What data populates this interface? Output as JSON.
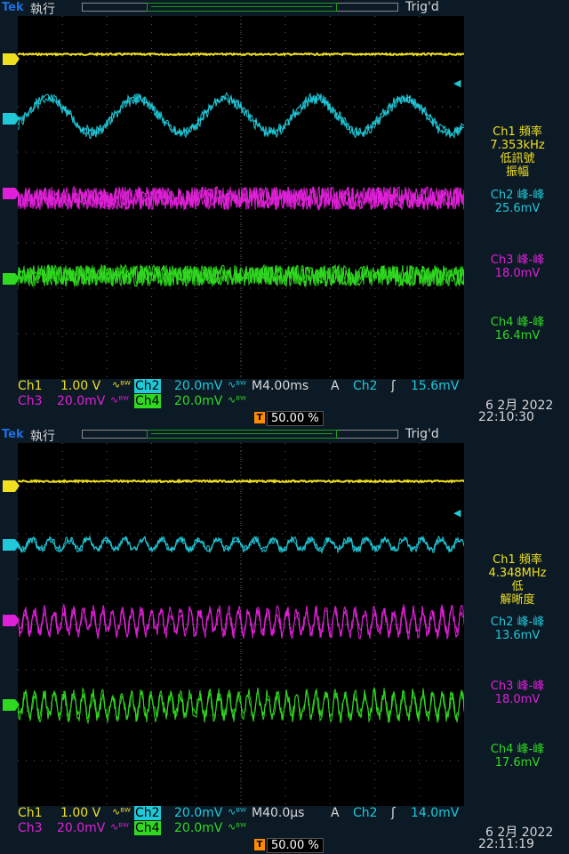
{
  "panels": [
    {
      "brand": "Tek",
      "run_state": "執行",
      "trig_status": "Trig'd",
      "trig_marker": "T",
      "channel_markers": [
        "1",
        "2",
        "3",
        "4"
      ],
      "measurements": {
        "ch1": [
          "Ch1 頻率",
          "7.353kHz",
          "低訊號",
          "振幅"
        ],
        "ch2": [
          "Ch2 峰-峰",
          "25.6mV"
        ],
        "ch3": [
          "Ch3 峰-峰",
          "18.0mV"
        ],
        "ch4": [
          "Ch4 峰-峰",
          "16.4mV"
        ]
      },
      "readout": {
        "ch1_label": "Ch1",
        "ch1_scale": "1.00 V",
        "ch2_label": "Ch2",
        "ch2_scale": "20.0mV",
        "ch3_label": "Ch3",
        "ch3_scale": "20.0mV",
        "ch4_label": "Ch4",
        "ch4_scale": "20.0mV",
        "coupling": "∿ᴮᵂ",
        "timebase": "M4.00ms",
        "trig_mode": "A",
        "trig_source": "Ch2",
        "trig_slope": "ʃ",
        "trig_level": "15.6mV",
        "trig_position": "50.00 %",
        "date": "6 2月  2022",
        "time": "22:10:30"
      },
      "waveforms": {
        "ch2_shape": "slow-sine",
        "ch2_cycles": 5
      }
    },
    {
      "brand": "Tek",
      "run_state": "執行",
      "trig_status": "Trig'd",
      "trig_marker": "T",
      "channel_markers": [
        "1",
        "2",
        "3",
        "4"
      ],
      "measurements": {
        "ch1": [
          "Ch1 頻率",
          "4.348MHz",
          "低",
          "解晰度"
        ],
        "ch2": [
          "Ch2 峰-峰",
          "13.6mV"
        ],
        "ch3": [
          "Ch3 峰-峰",
          "18.0mV"
        ],
        "ch4": [
          "Ch4 峰-峰",
          "17.6mV"
        ]
      },
      "readout": {
        "ch1_label": "Ch1",
        "ch1_scale": "1.00 V",
        "ch2_label": "Ch2",
        "ch2_scale": "20.0mV",
        "ch3_label": "Ch3",
        "ch3_scale": "20.0mV",
        "ch4_label": "Ch4",
        "ch4_scale": "20.0mV",
        "coupling": "∿ᴮᵂ",
        "timebase": "M40.0µs",
        "trig_mode": "A",
        "trig_source": "Ch2",
        "trig_slope": "ʃ",
        "trig_level": "14.0mV",
        "trig_position": "50.00 %",
        "date": "6 2月  2022",
        "time": "22:11:19"
      },
      "waveforms": {
        "ch2_shape": "fast-ripple",
        "ch2_cycles": 24
      }
    }
  ],
  "colors": {
    "ch1": "#f0e020",
    "ch2": "#20c8d8",
    "ch3": "#e020d8",
    "ch4": "#30d820",
    "grid": "#5a5a5a",
    "trigger": "#ff8a00",
    "screen_bg": "#000000",
    "bezel_bg": "#0c1a26"
  }
}
